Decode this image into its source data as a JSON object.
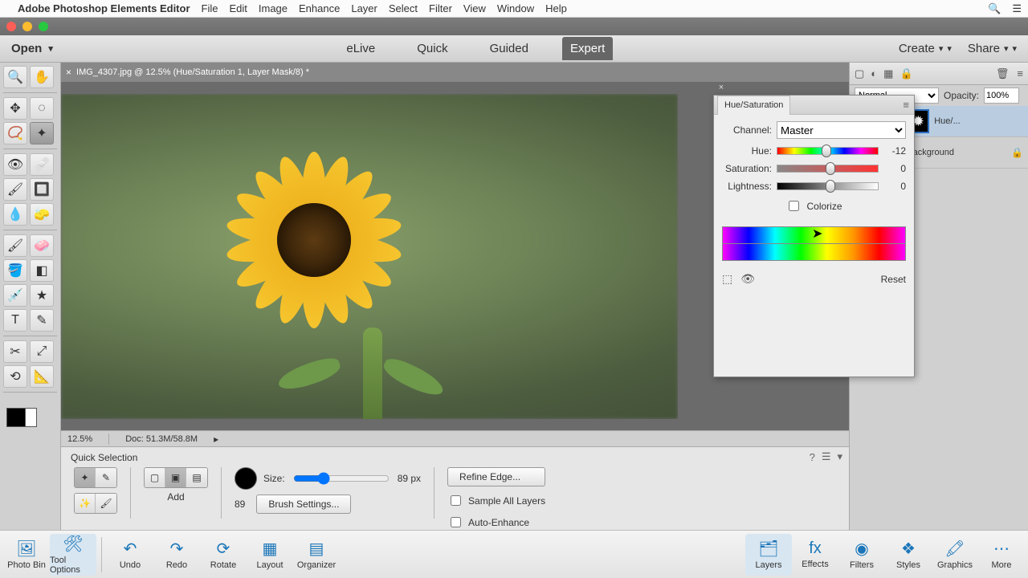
{
  "menubar": {
    "app": "Adobe Photoshop Elements Editor",
    "items": [
      "File",
      "Edit",
      "Image",
      "Enhance",
      "Layer",
      "Select",
      "Filter",
      "View",
      "Window",
      "Help"
    ]
  },
  "taskbar": {
    "open": "Open",
    "modes": {
      "elive": "eLive",
      "quick": "Quick",
      "guided": "Guided",
      "expert": "Expert"
    },
    "create": "Create",
    "share": "Share"
  },
  "document": {
    "tab_title": "IMG_4307.jpg @ 12.5% (Hue/Saturation 1, Layer Mask/8) *",
    "zoom": "12.5%",
    "doc_size": "Doc: 51.3M/58.8M"
  },
  "hs_panel": {
    "title": "Hue/Saturation",
    "channel_label": "Channel:",
    "channel": "Master",
    "hue_label": "Hue:",
    "hue_value": "-12",
    "sat_label": "Saturation:",
    "sat_value": "0",
    "lig_label": "Lightness:",
    "lig_value": "0",
    "colorize": "Colorize",
    "reset": "Reset"
  },
  "right_panel": {
    "blend": "Normal",
    "opacity_label": "Opacity:",
    "opacity_value": "100%",
    "layers": {
      "hue_sat": "Hue/...",
      "background": "Background"
    }
  },
  "options": {
    "title": "Quick Selection",
    "add": "Add",
    "size_label": "Size:",
    "size_value": "89 px",
    "size_num": "89",
    "brush_settings": "Brush Settings...",
    "refine_edge": "Refine Edge...",
    "sample_all": "Sample All Layers",
    "auto_enhance": "Auto-Enhance"
  },
  "bottom_bar": {
    "photo_bin": "Photo Bin",
    "tool_options": "Tool Options",
    "undo": "Undo",
    "redo": "Redo",
    "rotate": "Rotate",
    "layout": "Layout",
    "organizer": "Organizer",
    "layers": "Layers",
    "effects": "Effects",
    "filters": "Filters",
    "styles": "Styles",
    "graphics": "Graphics",
    "more": "More"
  }
}
